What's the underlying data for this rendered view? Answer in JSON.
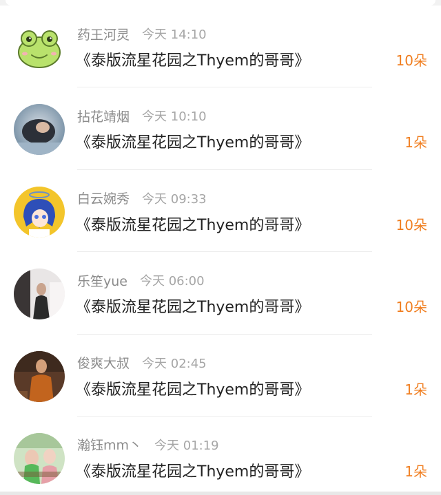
{
  "colors": {
    "accent": "#f07d1e",
    "name_text": "#8c8c8c",
    "time_text": "#a6a6a6",
    "title_text": "#222222"
  },
  "gifts": [
    {
      "name": "药王河灵",
      "time": "今天 14:10",
      "title": "《泰版流星花园之Thyem的哥哥》",
      "count": "10朵",
      "avatar": "frog-avatar-icon"
    },
    {
      "name": "拈花靖烟",
      "time": "今天 10:10",
      "title": "《泰版流星花园之Thyem的哥哥》",
      "count": "1朵",
      "avatar": "photo-avatar"
    },
    {
      "name": "白云婉秀",
      "time": "今天 09:33",
      "title": "《泰版流星花园之Thyem的哥哥》",
      "count": "10朵",
      "avatar": "anime-avatar"
    },
    {
      "name": "乐笙yue",
      "time": "今天 06:00",
      "title": "《泰版流星花园之Thyem的哥哥》",
      "count": "10朵",
      "avatar": "photo-avatar"
    },
    {
      "name": "俊爽大叔",
      "time": "今天 02:45",
      "title": "《泰版流星花园之Thyem的哥哥》",
      "count": "1朵",
      "avatar": "photo-avatar"
    },
    {
      "name": "瀚钰mm丶",
      "time": "今天 01:19",
      "title": "《泰版流星花园之Thyem的哥哥》",
      "count": "1朵",
      "avatar": "photo-avatar"
    }
  ]
}
